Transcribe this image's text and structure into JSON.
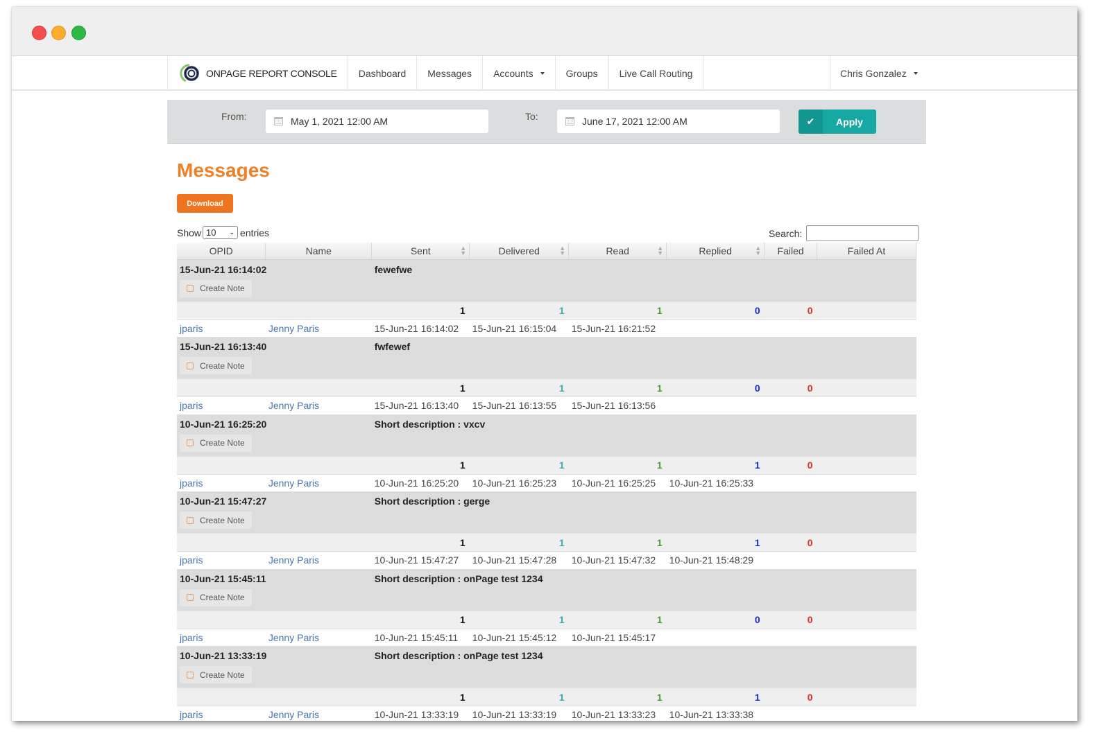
{
  "window": {
    "controls": [
      "close",
      "minimize",
      "maximize"
    ]
  },
  "nav": {
    "brand": "ONPAGE REPORT CONSOLE",
    "items": [
      {
        "label": "Dashboard",
        "dropdown": false
      },
      {
        "label": "Messages",
        "dropdown": false
      },
      {
        "label": "Accounts",
        "dropdown": true
      },
      {
        "label": "Groups",
        "dropdown": false
      },
      {
        "label": "Live Call Routing",
        "dropdown": false
      }
    ],
    "user": "Chris Gonzalez"
  },
  "filter": {
    "from_label": "From:",
    "from_value": "May 1, 2021 12:00 AM",
    "to_label": "To:",
    "to_value": "June 17, 2021 12:00 AM",
    "apply_label": "Apply",
    "apply_icon": "check-icon"
  },
  "page": {
    "title": "Messages",
    "download_label": "Download",
    "show_label": "Show",
    "entries_value": "10",
    "entries_label": "entries",
    "search_label": "Search:",
    "search_value": ""
  },
  "colors": {
    "accent_orange": "#f07f25",
    "apply_teal": "#18a8a3",
    "delivered": "#31b0b3",
    "read": "#4b9a2b",
    "replied": "#1f2bc9",
    "failed": "#e12a2a",
    "link": "#4a76a8"
  },
  "table": {
    "columns": [
      {
        "label": "OPID",
        "sortable": false
      },
      {
        "label": "Name",
        "sortable": false
      },
      {
        "label": "Sent",
        "sortable": true
      },
      {
        "label": "Delivered",
        "sortable": true
      },
      {
        "label": "Read",
        "sortable": true
      },
      {
        "label": "Replied",
        "sortable": true
      },
      {
        "label": "Failed",
        "sortable": false
      },
      {
        "label": "Failed At",
        "sortable": false
      }
    ],
    "create_note_label": "Create Note",
    "messages": [
      {
        "timestamp": "15-Jun-21 16:14:02",
        "description": "fewefwe",
        "counts": {
          "sent": "1",
          "delivered": "1",
          "read": "1",
          "replied": "0",
          "failed": "0"
        },
        "recipient": {
          "opid": "jparis",
          "name": "Jenny Paris",
          "sent": "15-Jun-21 16:14:02",
          "delivered": "15-Jun-21 16:15:04",
          "read": "15-Jun-21 16:21:52",
          "replied": "",
          "failed_at": ""
        }
      },
      {
        "timestamp": "15-Jun-21 16:13:40",
        "description": "fwfewef",
        "counts": {
          "sent": "1",
          "delivered": "1",
          "read": "1",
          "replied": "0",
          "failed": "0"
        },
        "recipient": {
          "opid": "jparis",
          "name": "Jenny Paris",
          "sent": "15-Jun-21 16:13:40",
          "delivered": "15-Jun-21 16:13:55",
          "read": "15-Jun-21 16:13:56",
          "replied": "",
          "failed_at": ""
        }
      },
      {
        "timestamp": "10-Jun-21 16:25:20",
        "description": "Short description : vxcv",
        "counts": {
          "sent": "1",
          "delivered": "1",
          "read": "1",
          "replied": "1",
          "failed": "0"
        },
        "recipient": {
          "opid": "jparis",
          "name": "Jenny Paris",
          "sent": "10-Jun-21 16:25:20",
          "delivered": "10-Jun-21 16:25:23",
          "read": "10-Jun-21 16:25:25",
          "replied": "10-Jun-21 16:25:33",
          "failed_at": ""
        }
      },
      {
        "timestamp": "10-Jun-21 15:47:27",
        "description": "Short description : gerge",
        "counts": {
          "sent": "1",
          "delivered": "1",
          "read": "1",
          "replied": "1",
          "failed": "0"
        },
        "recipient": {
          "opid": "jparis",
          "name": "Jenny Paris",
          "sent": "10-Jun-21 15:47:27",
          "delivered": "10-Jun-21 15:47:28",
          "read": "10-Jun-21 15:47:32",
          "replied": "10-Jun-21 15:48:29",
          "failed_at": ""
        }
      },
      {
        "timestamp": "10-Jun-21 15:45:11",
        "description": "Short description : onPage test 1234",
        "counts": {
          "sent": "1",
          "delivered": "1",
          "read": "1",
          "replied": "0",
          "failed": "0"
        },
        "recipient": {
          "opid": "jparis",
          "name": "Jenny Paris",
          "sent": "10-Jun-21 15:45:11",
          "delivered": "10-Jun-21 15:45:12",
          "read": "10-Jun-21 15:45:17",
          "replied": "",
          "failed_at": ""
        }
      },
      {
        "timestamp": "10-Jun-21 13:33:19",
        "description": "Short description : onPage test 1234",
        "counts": {
          "sent": "1",
          "delivered": "1",
          "read": "1",
          "replied": "1",
          "failed": "0"
        },
        "recipient": {
          "opid": "jparis",
          "name": "Jenny Paris",
          "sent": "10-Jun-21 13:33:19",
          "delivered": "10-Jun-21 13:33:19",
          "read": "10-Jun-21 13:33:23",
          "replied": "10-Jun-21 13:33:38",
          "failed_at": ""
        }
      }
    ]
  }
}
